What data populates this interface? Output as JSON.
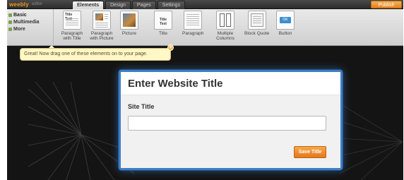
{
  "app": {
    "logo_text": "weebly",
    "logo_suffix": "editor",
    "tabs": [
      {
        "label": "Elements",
        "active": true
      },
      {
        "label": "Design",
        "active": false
      },
      {
        "label": "Pages",
        "active": false
      },
      {
        "label": "Settings",
        "active": false
      }
    ],
    "publish_label": "Publish",
    "accent_color": "#f29a1e"
  },
  "sidebar": {
    "categories": [
      {
        "label": "Basic",
        "active": true
      },
      {
        "label": "Multimedia",
        "active": false
      },
      {
        "label": "More",
        "active": false
      }
    ]
  },
  "elements": [
    {
      "label": "Paragraph with Title",
      "icon": "paragraph-with-title-icon",
      "icon_text": "Title Text"
    },
    {
      "label": "Paragraph with Picture",
      "icon": "paragraph-with-picture-icon"
    },
    {
      "label": "Picture",
      "icon": "picture-icon"
    },
    {
      "label": "Title",
      "icon": "title-icon",
      "icon_text": "Title Text"
    },
    {
      "label": "Paragraph",
      "icon": "paragraph-icon"
    },
    {
      "label": "Multiple Columns",
      "icon": "multiple-columns-icon"
    },
    {
      "label": "Block Quote",
      "icon": "block-quote-icon"
    },
    {
      "label": "Button",
      "icon": "button-icon",
      "icon_text": "OK"
    }
  ],
  "tooltip": {
    "text": "Great! Now drag one of these elements on to your page."
  },
  "modal": {
    "title": "Enter Website Title",
    "field_label": "Site Title",
    "field_value": "",
    "save_label": "Save Title",
    "border_color": "#3c7fc6",
    "button_color": "#e5761a"
  }
}
